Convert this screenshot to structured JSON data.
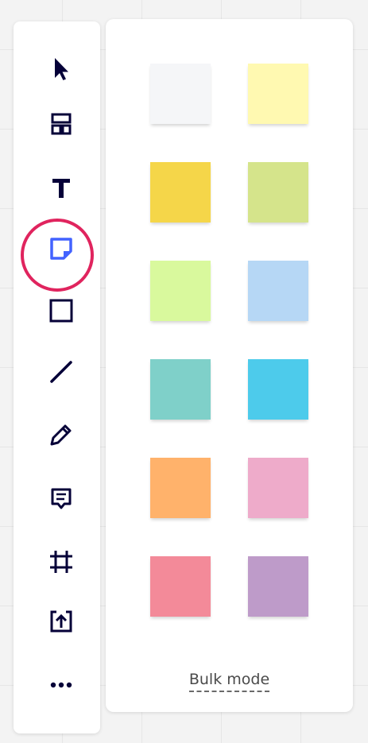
{
  "toolbar": {
    "tools": [
      {
        "name": "select",
        "icon": "cursor-arrow-icon"
      },
      {
        "name": "templates",
        "icon": "templates-icon"
      },
      {
        "name": "text",
        "icon": "text-t-icon",
        "glyph": "T"
      },
      {
        "name": "sticky-note",
        "icon": "sticky-note-icon",
        "active": true
      },
      {
        "name": "shape",
        "icon": "square-icon"
      },
      {
        "name": "line",
        "icon": "line-icon"
      },
      {
        "name": "pen",
        "icon": "pen-icon"
      },
      {
        "name": "comment",
        "icon": "comment-icon"
      },
      {
        "name": "frame",
        "icon": "frame-icon"
      },
      {
        "name": "upload",
        "icon": "upload-icon"
      },
      {
        "name": "more",
        "icon": "more-dots-icon"
      }
    ],
    "active_color": "#4262ff",
    "highlight_color": "#e0245e"
  },
  "sticky_panel": {
    "swatches": [
      {
        "color": "#f5f6f8"
      },
      {
        "color": "#fff9b1"
      },
      {
        "color": "#f5d649"
      },
      {
        "color": "#d5e48b"
      },
      {
        "color": "#d9f99d"
      },
      {
        "color": "#b6d7f5"
      },
      {
        "color": "#7fd0c9"
      },
      {
        "color": "#4dcbeb"
      },
      {
        "color": "#ffb26b"
      },
      {
        "color": "#eeabca"
      },
      {
        "color": "#f38a99"
      },
      {
        "color": "#be9bc9"
      }
    ],
    "bulk_mode_label": "Bulk mode"
  }
}
